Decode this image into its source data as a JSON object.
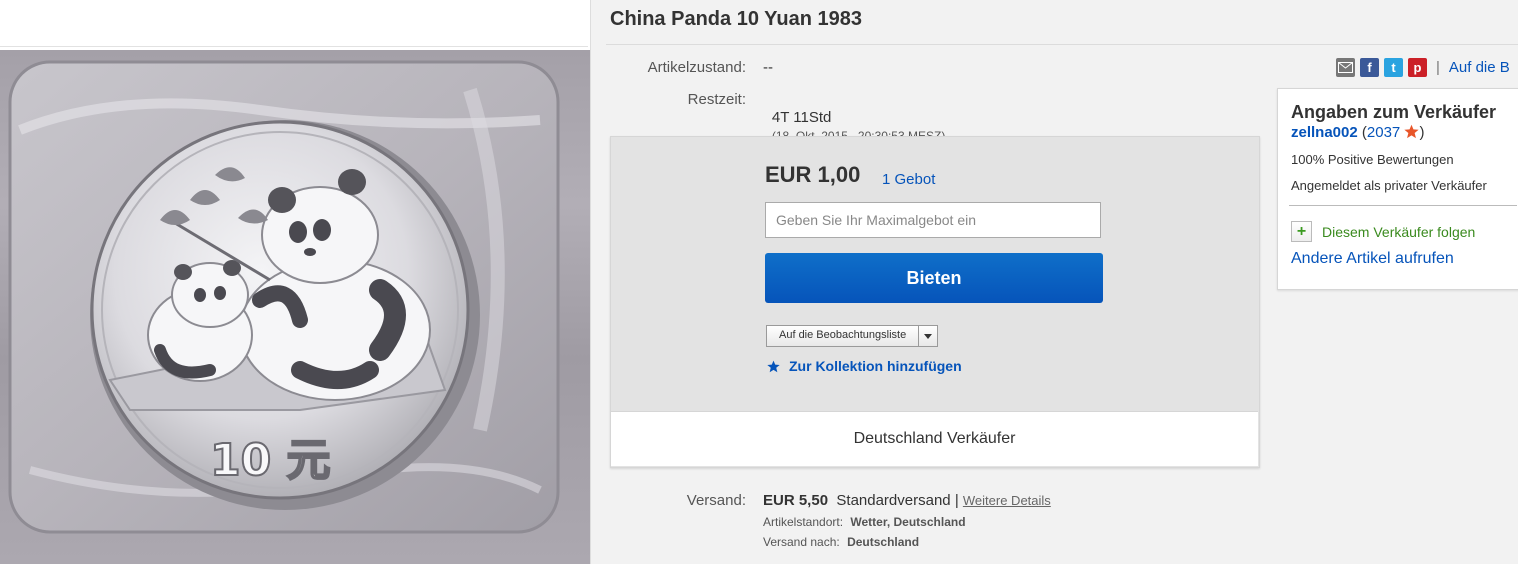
{
  "item": {
    "title": "China Panda 10 Yuan 1983",
    "coin_denomination": "10 元"
  },
  "details": {
    "condition_label": "Artikelzustand:",
    "condition_value": "--",
    "time_label": "Restzeit:",
    "time_value": "4T 11Std",
    "time_end": "(18. Okt. 2015   20:30:53 MESZ)"
  },
  "bid": {
    "price": "EUR 1,00",
    "bid_count": "1 Gebot",
    "input_placeholder": "Geben Sie Ihr Maximalgebot ein",
    "button_label": "Bieten",
    "watchlist_label": "Auf die Beobachtungsliste",
    "collection_label": "Zur Kollektion hinzufügen",
    "footer_text": "Deutschland Verkäufer"
  },
  "shipping": {
    "label": "Versand:",
    "price": "EUR 5,50",
    "method": "Standardversand",
    "separator": "|",
    "details_link": "Weitere Details",
    "location_label": "Artikelstandort:",
    "location_value": "Wetter, Deutschland",
    "ships_to_label": "Versand nach:",
    "ships_to_value": "Deutschland"
  },
  "share": {
    "icons": [
      "email-icon",
      "facebook-icon",
      "twitter-icon",
      "pinterest-icon"
    ],
    "separator": "|",
    "watch_link": "Auf die B"
  },
  "seller": {
    "heading": "Angaben zum Verkäufer",
    "username": "zellna002",
    "open_paren": "(",
    "feedback_score": "2037",
    "close_paren": ")",
    "positive": "100% Positive Bewertungen",
    "registered": "Angemeldet als privater Verkäufer",
    "follow": "Diesem Verkäufer folgen",
    "other_items": "Andere Artikel aufrufen"
  },
  "colors": {
    "link": "#0654ba",
    "button": "#0654ba",
    "follow_green": "#3a8a1e",
    "star": "#e8562a"
  }
}
